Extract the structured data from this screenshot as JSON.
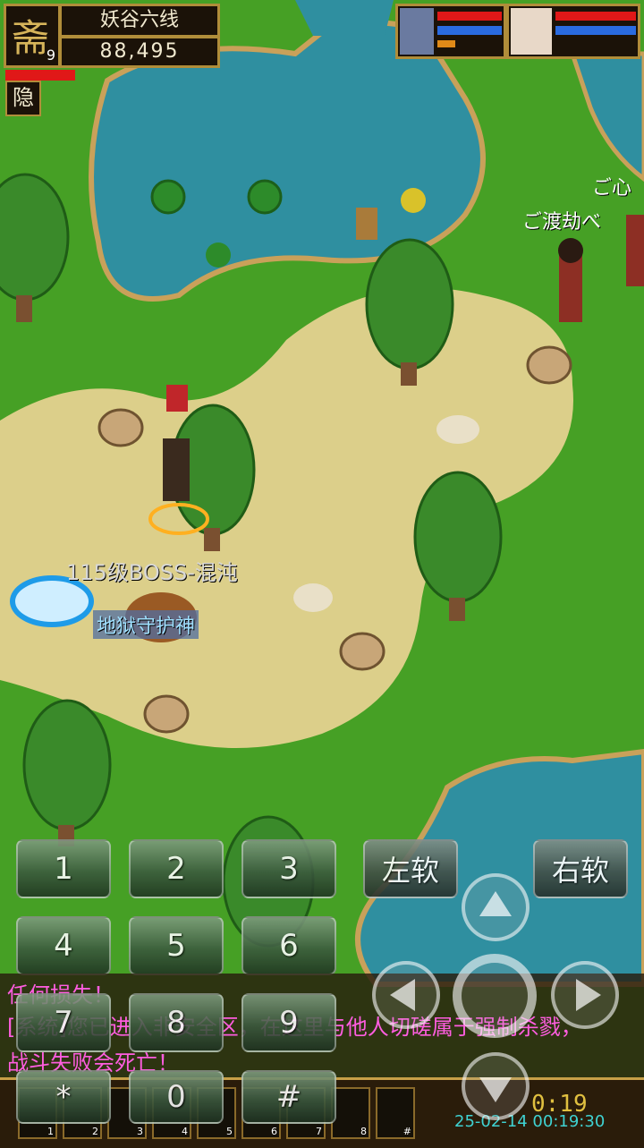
{
  "hud": {
    "map_name": "妖谷六线",
    "coords": "88,495",
    "level": "9",
    "title_char": "斋",
    "hide_button": "隐"
  },
  "world": {
    "boss_label": "115级BOSS-混沌",
    "guardian_label": "地狱守护神",
    "npc_label_1": "ご渡劫べ",
    "npc_label_2": "ご心"
  },
  "keypad": {
    "keys": [
      "1",
      "2",
      "3",
      "4",
      "5",
      "6",
      "7",
      "8",
      "9",
      "*",
      "0",
      "#"
    ],
    "left_soft": "左软",
    "right_soft": "右软"
  },
  "chat": {
    "line1": "任何损失！",
    "line2": "[系统]您已进入非安全区，在这里与他人切磋属于强制杀戮，",
    "line3": "战斗失败会死亡！"
  },
  "toolbar": {
    "timer": "0:19",
    "timestamp": "25-02-14 00:19:30",
    "slot_numbers": [
      "1",
      "2",
      "3",
      "4",
      "5",
      "6",
      "7",
      "8",
      "#"
    ]
  },
  "colors": {
    "water": "#2f8fa0",
    "grass": "#4ea82a",
    "path": "#dccf8a",
    "chat_text": "#ff5de0",
    "hp_bar": "#e01818",
    "mp_bar": "#2a6be0"
  }
}
